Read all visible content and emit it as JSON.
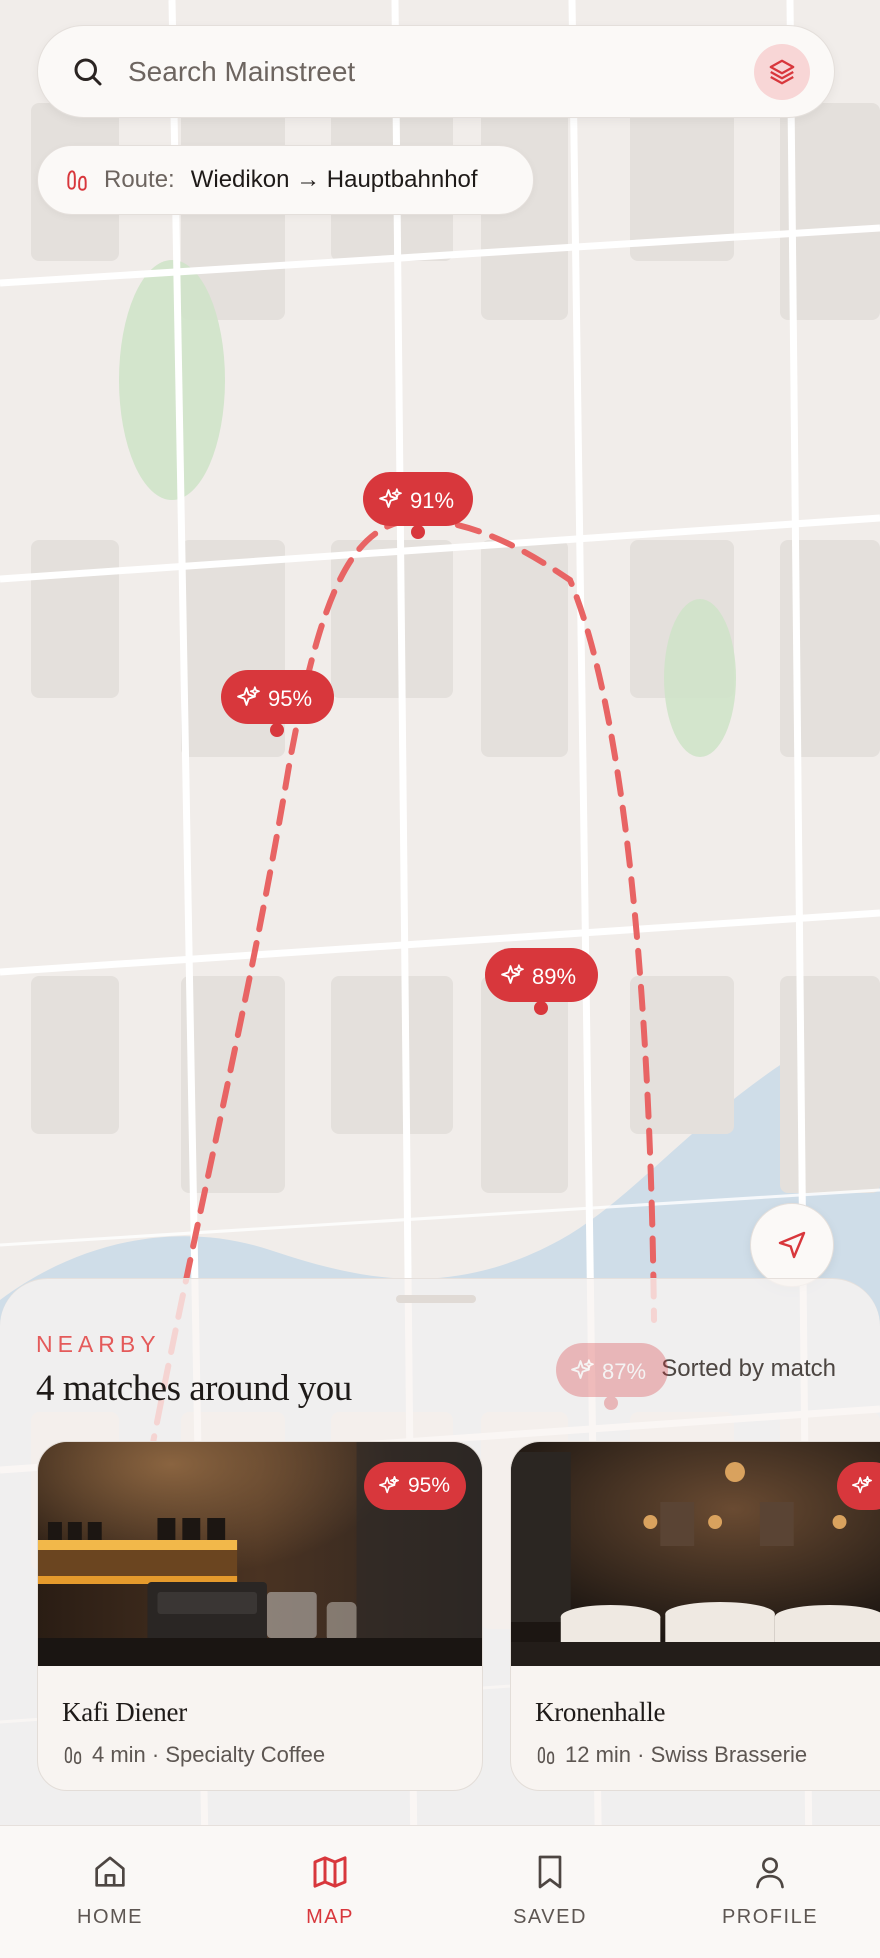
{
  "search": {
    "placeholder": "Search Mainstreet"
  },
  "route": {
    "label": "Route:",
    "value": "Wiedikon → Hauptbahnhof"
  },
  "pins": [
    {
      "score": "95%"
    },
    {
      "score": "91%"
    },
    {
      "score": "89%"
    },
    {
      "score": "87%"
    }
  ],
  "sheet": {
    "eyebrow": "NEARBY",
    "title": "4 matches around you",
    "sort_label": "Sorted by match"
  },
  "places": [
    {
      "name": "Kafi Diener",
      "meta": "4 min · Specialty Coffee",
      "score": "95%"
    },
    {
      "name": "Kronenhalle",
      "meta": "12 min · Swiss Brasserie",
      "score": ""
    }
  ],
  "nav": [
    {
      "label": "HOME",
      "icon": "home-icon",
      "active": false
    },
    {
      "label": "MAP",
      "icon": "map-icon",
      "active": true
    },
    {
      "label": "SAVED",
      "icon": "bookmark-icon",
      "active": false
    },
    {
      "label": "PROFILE",
      "icon": "user-icon",
      "active": false
    }
  ],
  "colors": {
    "accent": "#d8373c",
    "route_line": "#e86464",
    "map_bg": "#f1edea",
    "water": "#cfdde8",
    "park": "#cfe3c9"
  }
}
